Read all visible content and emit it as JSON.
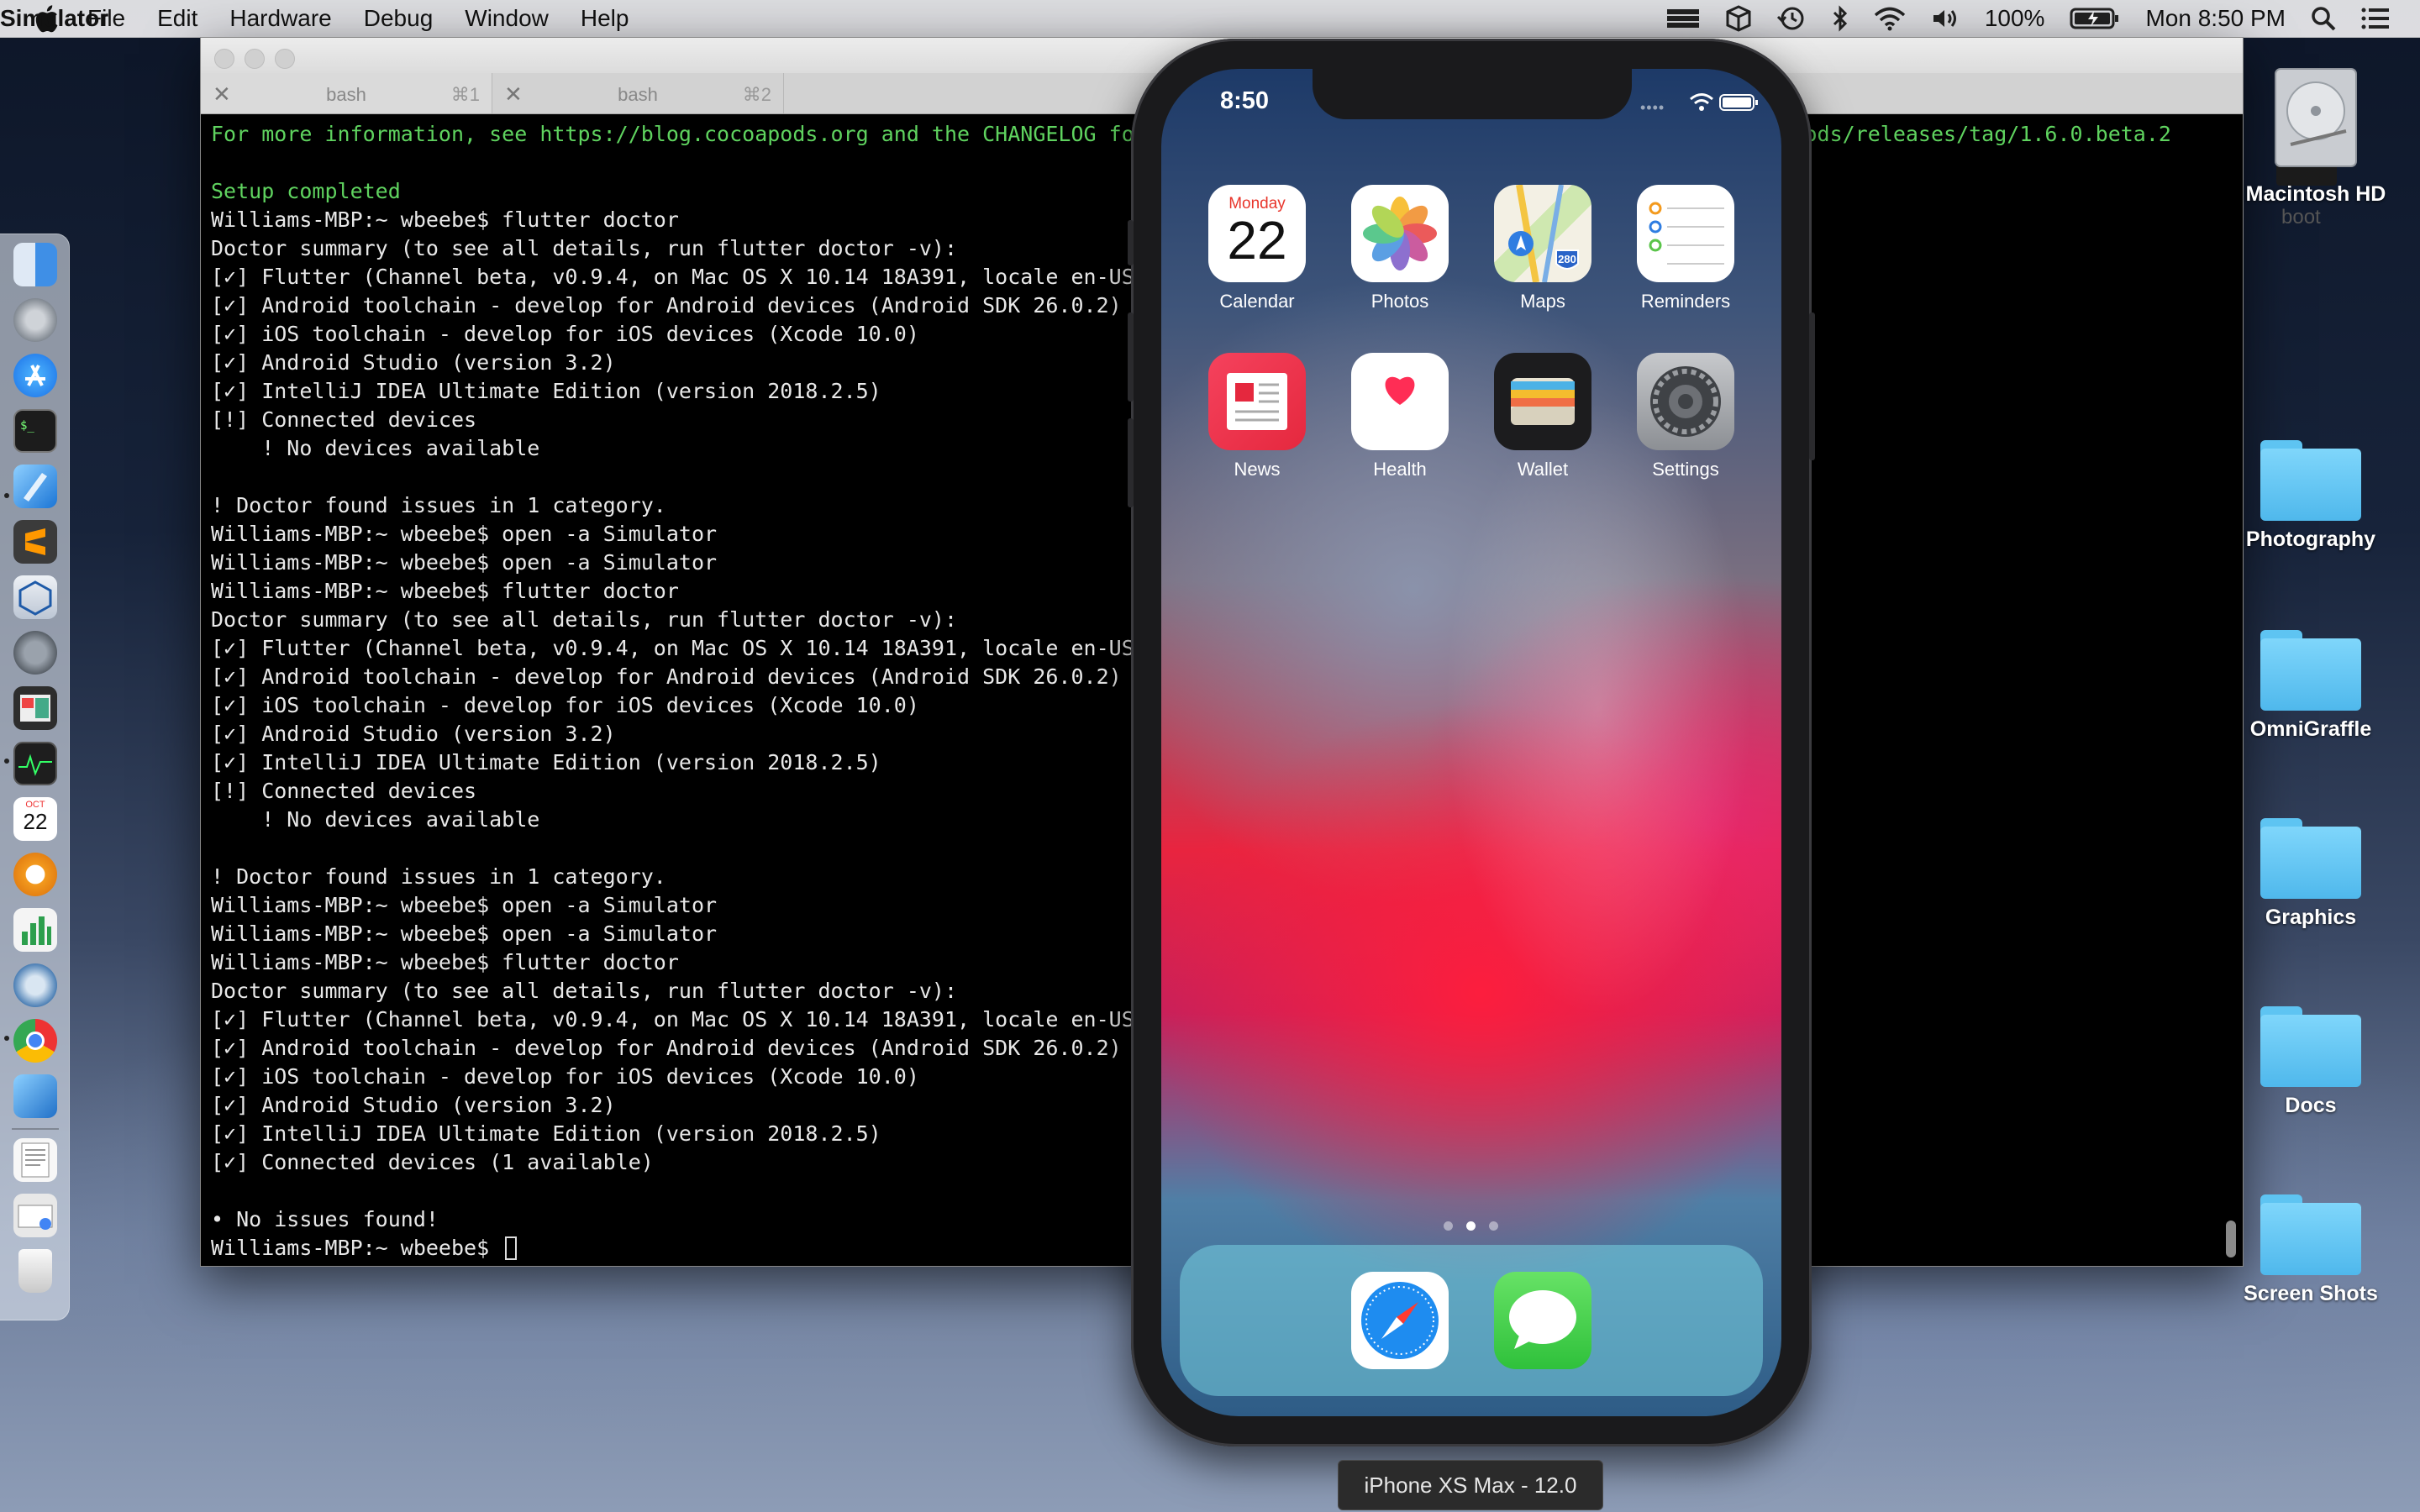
{
  "menubar": {
    "app": "Simulator",
    "menus": [
      "File",
      "Edit",
      "Hardware",
      "Debug",
      "Window",
      "Help"
    ],
    "battery": "100%",
    "clock": "Mon 8:50 PM"
  },
  "terminal": {
    "tabs": [
      {
        "title": "bash",
        "shortcut": "⌘1"
      },
      {
        "title": "bash",
        "shortcut": "⌘2"
      }
    ],
    "right_label": "boot",
    "lines": [
      {
        "text": "For more information, see https://blog.cocoapods.org and the CHANGELOG for this version at https://github.com/CocoaPods/CocoaPods/releases/tag/1.6.0.beta.2",
        "color": "green"
      },
      {
        "text": "",
        "color": ""
      },
      {
        "text": "Setup completed",
        "color": "green"
      },
      {
        "text": "Williams-MBP:~ wbeebe$ flutter doctor",
        "color": ""
      },
      {
        "text": "Doctor summary (to see all details, run flutter doctor -v):",
        "color": ""
      },
      {
        "text": "[✓] Flutter (Channel beta, v0.9.4, on Mac OS X 10.14 18A391, locale en-US)",
        "color": ""
      },
      {
        "text": "[✓] Android toolchain - develop for Android devices (Android SDK 26.0.2)",
        "color": ""
      },
      {
        "text": "[✓] iOS toolchain - develop for iOS devices (Xcode 10.0)",
        "color": ""
      },
      {
        "text": "[✓] Android Studio (version 3.2)",
        "color": ""
      },
      {
        "text": "[✓] IntelliJ IDEA Ultimate Edition (version 2018.2.5)",
        "color": ""
      },
      {
        "text": "[!] Connected devices",
        "color": ""
      },
      {
        "text": "    ! No devices available",
        "color": ""
      },
      {
        "text": "",
        "color": ""
      },
      {
        "text": "! Doctor found issues in 1 category.",
        "color": ""
      },
      {
        "text": "Williams-MBP:~ wbeebe$ open -a Simulator",
        "color": ""
      },
      {
        "text": "Williams-MBP:~ wbeebe$ open -a Simulator",
        "color": ""
      },
      {
        "text": "Williams-MBP:~ wbeebe$ flutter doctor",
        "color": ""
      },
      {
        "text": "Doctor summary (to see all details, run flutter doctor -v):",
        "color": ""
      },
      {
        "text": "[✓] Flutter (Channel beta, v0.9.4, on Mac OS X 10.14 18A391, locale en-US)",
        "color": ""
      },
      {
        "text": "[✓] Android toolchain - develop for Android devices (Android SDK 26.0.2)",
        "color": ""
      },
      {
        "text": "[✓] iOS toolchain - develop for iOS devices (Xcode 10.0)",
        "color": ""
      },
      {
        "text": "[✓] Android Studio (version 3.2)",
        "color": ""
      },
      {
        "text": "[✓] IntelliJ IDEA Ultimate Edition (version 2018.2.5)",
        "color": ""
      },
      {
        "text": "[!] Connected devices",
        "color": ""
      },
      {
        "text": "    ! No devices available",
        "color": ""
      },
      {
        "text": "",
        "color": ""
      },
      {
        "text": "! Doctor found issues in 1 category.",
        "color": ""
      },
      {
        "text": "Williams-MBP:~ wbeebe$ open -a Simulator",
        "color": ""
      },
      {
        "text": "Williams-MBP:~ wbeebe$ open -a Simulator",
        "color": ""
      },
      {
        "text": "Williams-MBP:~ wbeebe$ flutter doctor",
        "color": ""
      },
      {
        "text": "Doctor summary (to see all details, run flutter doctor -v):",
        "color": ""
      },
      {
        "text": "[✓] Flutter (Channel beta, v0.9.4, on Mac OS X 10.14 18A391, locale en-US)",
        "color": ""
      },
      {
        "text": "[✓] Android toolchain - develop for Android devices (Android SDK 26.0.2)",
        "color": ""
      },
      {
        "text": "[✓] iOS toolchain - develop for iOS devices (Xcode 10.0)",
        "color": ""
      },
      {
        "text": "[✓] Android Studio (version 3.2)",
        "color": ""
      },
      {
        "text": "[✓] IntelliJ IDEA Ultimate Edition (version 2018.2.5)",
        "color": ""
      },
      {
        "text": "[✓] Connected devices (1 available)",
        "color": ""
      },
      {
        "text": "",
        "color": ""
      },
      {
        "text": "• No issues found!",
        "color": ""
      },
      {
        "text": "Williams-MBP:~ wbeebe$ ",
        "color": "",
        "cursor": true
      }
    ]
  },
  "phone": {
    "time": "8:50",
    "calendar_day": "Monday",
    "calendar_date": "22",
    "maps_shield": "280",
    "apps": [
      "Calendar",
      "Photos",
      "Maps",
      "Reminders",
      "News",
      "Health",
      "Wallet",
      "Settings"
    ],
    "dock_apps": [
      "Safari",
      "Messages"
    ],
    "pages": 3,
    "current_page": 2
  },
  "desktop": {
    "drive": "Macintosh HD",
    "folders": [
      "Photography",
      "OmniGraffle",
      "Graphics",
      "Docs",
      "Screen Shots"
    ]
  },
  "simulator_device_label": "iPhone XS Max - 12.0",
  "dock": {
    "calendar_month": "OCT",
    "calendar_day": "22"
  },
  "colors": {
    "terminal_green": "#5fd35f",
    "folder_blue": "#5ec4f2"
  }
}
